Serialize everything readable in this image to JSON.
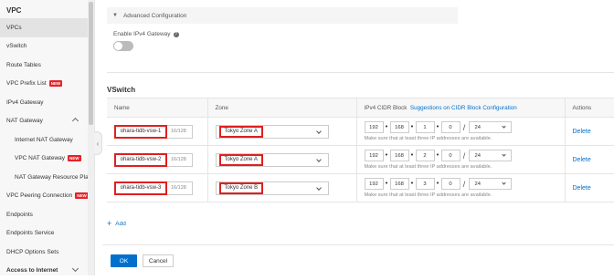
{
  "sidebar": {
    "title": "VPC",
    "items": [
      {
        "label": "VPCs",
        "active": true
      },
      {
        "label": "vSwitch"
      },
      {
        "label": "Route Tables"
      },
      {
        "label": "VPC Prefix List",
        "badge": "NEW"
      },
      {
        "label": "IPv4 Gateway"
      },
      {
        "label": "NAT Gateway",
        "expanded": true
      },
      {
        "label": "Internet NAT Gateway",
        "sub": true
      },
      {
        "label": "VPC NAT Gateway",
        "sub": true,
        "badge": "NEW"
      },
      {
        "label": "NAT Gateway Resource Plan",
        "sub": true
      },
      {
        "label": "VPC Peering Connection",
        "badge": "NEW"
      },
      {
        "label": "Endpoints"
      },
      {
        "label": "Endpoints Service"
      },
      {
        "label": "DHCP Options Sets"
      },
      {
        "label": "Access to Internet",
        "section": true
      }
    ]
  },
  "main": {
    "advanced_config_label": "Advanced Configuration",
    "ipv4_gateway_label": "Enable IPv4 Gateway",
    "ipv4_gateway_enabled": false,
    "vswitch_title": "VSwitch",
    "table": {
      "headers": {
        "name": "Name",
        "zone": "Zone",
        "cidr": "IPv4 CIDR Block",
        "cidr_link": "Suggestions on CIDR Block Configuration",
        "actions": "Actions"
      },
      "rows": [
        {
          "name": "ohara-tidb-vsw-1",
          "count": "16/128",
          "zone": "Tokyo Zone A",
          "o1": "192",
          "o2": "168",
          "o3": "1",
          "o4": "0",
          "mask": "24",
          "hint": "Make sure that at least three IP addresses are available.",
          "action": "Delete"
        },
        {
          "name": "ohara-tidb-vsw-2",
          "count": "16/128",
          "zone": "Tokyo Zone A",
          "o1": "192",
          "o2": "168",
          "o3": "2",
          "o4": "0",
          "mask": "24",
          "hint": "Make sure that at least three IP addresses are available.",
          "action": "Delete"
        },
        {
          "name": "ohara-tidb-vsw-3",
          "count": "16/128",
          "zone": "Tokyo Zone B",
          "o1": "192",
          "o2": "168",
          "o3": "3",
          "o4": "0",
          "mask": "24",
          "hint": "Make sure that at least three IP addresses are available.",
          "action": "Delete"
        }
      ]
    },
    "add_label": "Add",
    "ok_label": "OK",
    "cancel_label": "Cancel"
  },
  "colors": {
    "accent": "#0070cc",
    "highlight": "#e01f1f",
    "badge": "#e5232a"
  }
}
